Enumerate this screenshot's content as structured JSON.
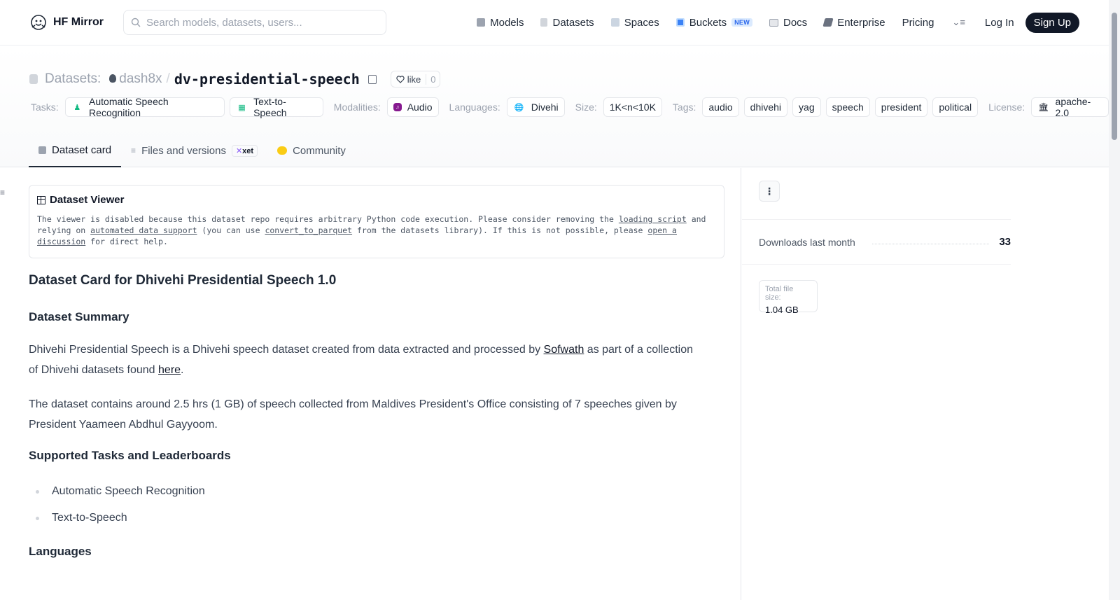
{
  "nav": {
    "brand": "HF Mirror",
    "search_placeholder": "Search models, datasets, users...",
    "links": [
      {
        "label": "Models",
        "icon": "cube-icon"
      },
      {
        "label": "Datasets",
        "icon": "database-icon"
      },
      {
        "label": "Spaces",
        "icon": "grid-icon"
      },
      {
        "label": "Buckets",
        "icon": "bucket-icon",
        "badge": "NEW"
      },
      {
        "label": "Docs",
        "icon": "book-icon"
      },
      {
        "label": "Enterprise",
        "icon": "enterprise-icon"
      },
      {
        "label": "Pricing"
      }
    ],
    "login": "Log In",
    "signup": "Sign Up"
  },
  "header": {
    "section": "Datasets:",
    "owner": "dash8x",
    "separator": "/",
    "repo": "dv-presidential-speech",
    "like_label": "like",
    "like_count": "0"
  },
  "tags": {
    "tasks_label": "Tasks:",
    "tasks": [
      "Automatic Speech Recognition",
      "Text-to-Speech"
    ],
    "modalities_label": "Modalities:",
    "modalities": [
      "Audio"
    ],
    "languages_label": "Languages:",
    "languages": [
      "Divehi"
    ],
    "size_label": "Size:",
    "size": "1K<n<10K",
    "tags_label": "Tags:",
    "tags": [
      "audio",
      "dhivehi",
      "yag",
      "speech",
      "president",
      "political"
    ],
    "license_label": "License:",
    "license": "apache-2.0"
  },
  "tabs": [
    {
      "label": "Dataset card",
      "active": true
    },
    {
      "label": "Files and versions",
      "badge": "xet"
    },
    {
      "label": "Community"
    }
  ],
  "viewer": {
    "title": "Dataset Viewer",
    "text_1": "The viewer is disabled because this dataset repo requires arbitrary Python code execution. Please consider removing the ",
    "link_1": "loading script",
    "text_2": " and relying on ",
    "link_2": "automated data support",
    "text_3": " (you can use ",
    "link_3": "convert_to_parquet",
    "text_4": " from the datasets library). If this is not possible, please ",
    "link_4": "open a discussion",
    "text_5": " for direct help."
  },
  "card": {
    "title": "Dataset Card for Dhivehi Presidential Speech 1.0",
    "summary_heading": "Dataset Summary",
    "summary_p1_a": "Dhivehi Presidential Speech is a Dhivehi speech dataset created from data extracted and processed by ",
    "summary_p1_link": "Sofwath",
    "summary_p1_b": " as part of a collection of Dhivehi datasets found ",
    "summary_p1_link2": "here",
    "summary_p1_c": ".",
    "summary_p2": "The dataset contains around 2.5 hrs (1 GB) of speech collected from Maldives President's Office consisting of 7 speeches given by President Yaameen Abdhul Gayyoom.",
    "tasks_heading": "Supported Tasks and Leaderboards",
    "tasks_list": [
      "Automatic Speech Recognition",
      "Text-to-Speech"
    ],
    "languages_heading": "Languages"
  },
  "sidebar": {
    "downloads_label": "Downloads last month",
    "downloads_count": "33",
    "file_size_label": "Total file size:",
    "file_size": "1.04 GB"
  }
}
